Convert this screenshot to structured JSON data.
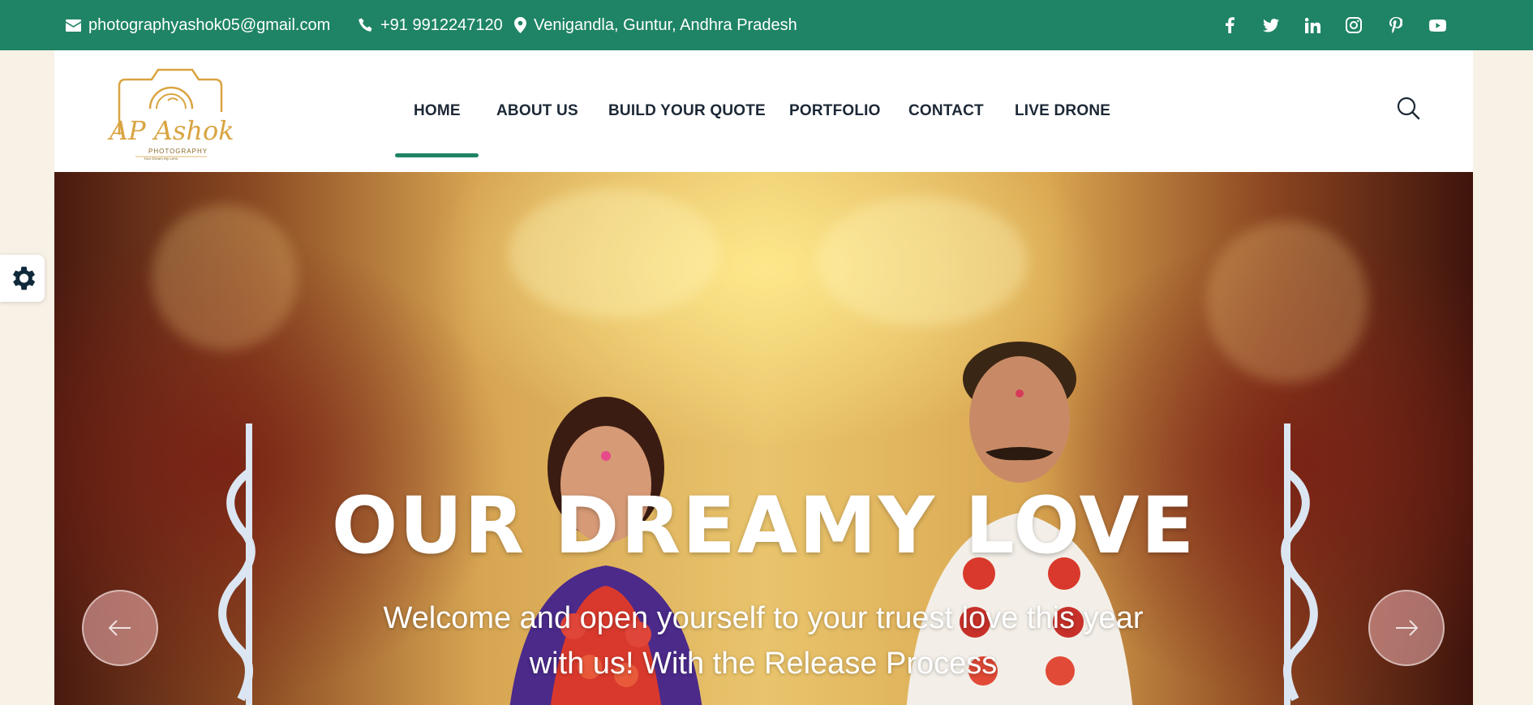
{
  "topbar": {
    "email": "photographyashok05@gmail.com",
    "phone": "+91 9912247120",
    "location": "Venigandla, Guntur, Andhra Pradesh",
    "icons": [
      "envelope-icon",
      "phone-icon",
      "map-pin-icon"
    ],
    "social": [
      "facebook-icon",
      "twitter-icon",
      "linkedin-icon",
      "instagram-icon",
      "pinterest-icon",
      "youtube-icon"
    ]
  },
  "logo": {
    "name": "AP Ashok",
    "tagline": "PHOTOGRAPHY",
    "motto": "Your Dream My Lens"
  },
  "nav": {
    "items": [
      "HOME",
      "ABOUT US",
      "BUILD YOUR QUOTE",
      "PORTFOLIO",
      "CONTACT",
      "LIVE DRONE"
    ],
    "active": "HOME"
  },
  "hero": {
    "title": "OUR DREAMY LOVE",
    "subtitle": "Welcome and open yourself to your truest love this year with us! With the Release Process"
  },
  "colors": {
    "brand_green": "#1f8466",
    "logo_gold": "#d9a441",
    "nav_text": "#1c2836"
  }
}
